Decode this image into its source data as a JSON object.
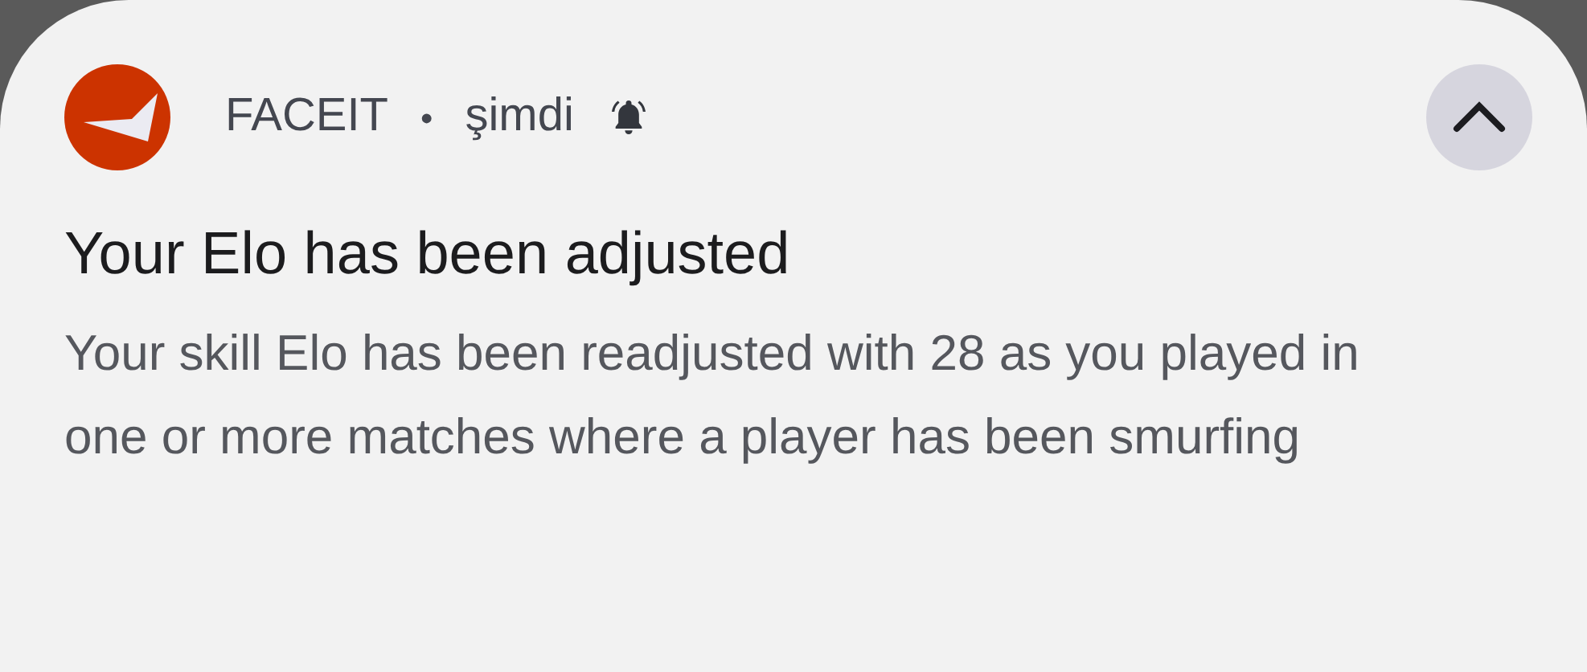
{
  "notification": {
    "app_name": "FACEIT",
    "separator": "•",
    "time": "şimdi",
    "alerting": true,
    "expanded": true,
    "title": "Your Elo has been adjusted",
    "body": "Your skill Elo has been readjusted with 28 as you played in one or more matches where a player has been smurfing"
  }
}
